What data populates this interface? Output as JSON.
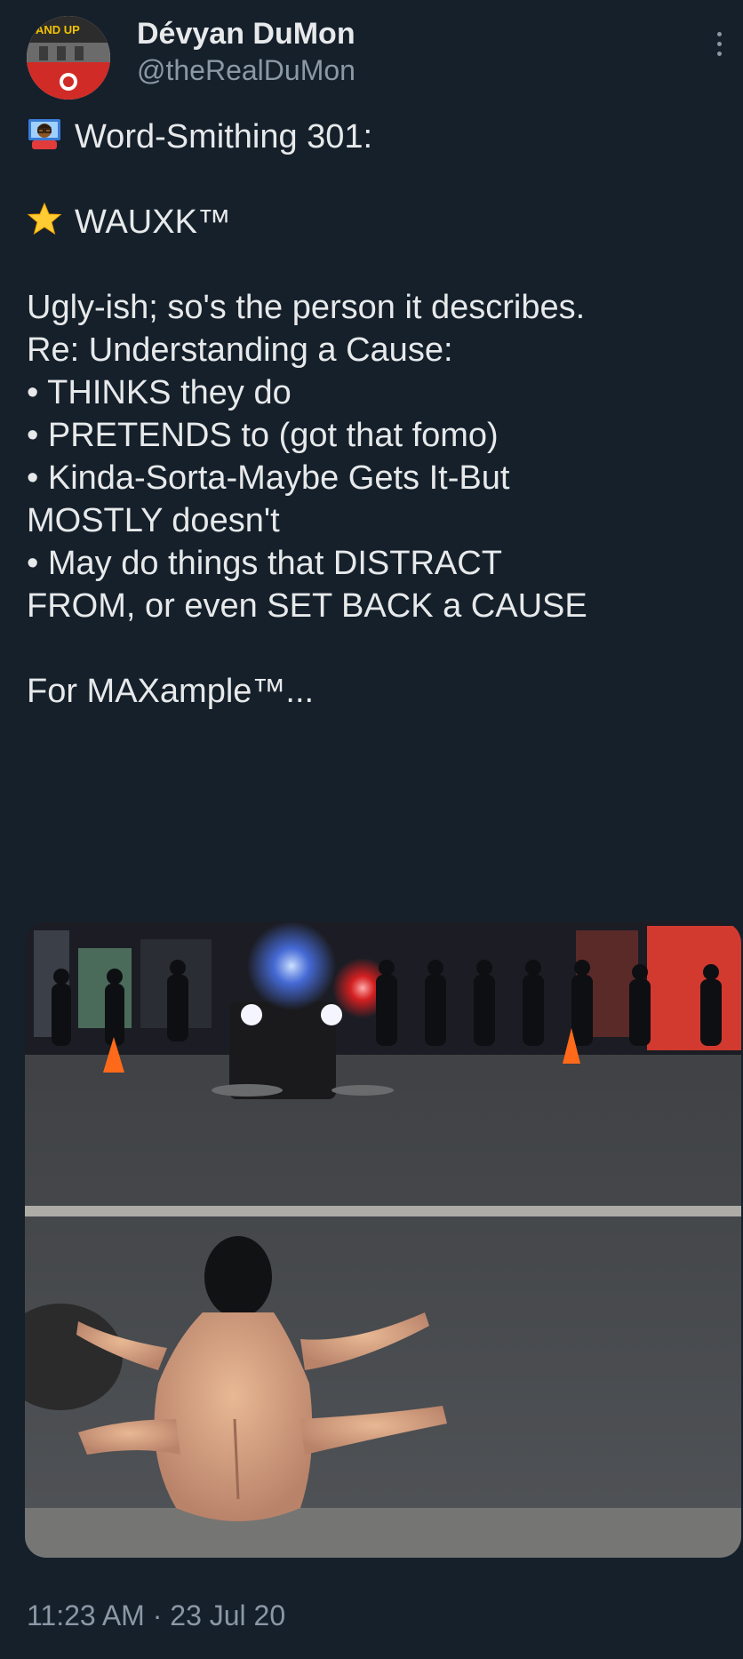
{
  "author": {
    "display_name": "Dévyan DuMon",
    "handle": "@theRealDuMon",
    "avatar_sign": "AND UP"
  },
  "tweet": {
    "heading": "Word-Smithing 301:",
    "term": "WAUXK™",
    "lines": [
      "Ugly-ish; so's the person it describes.",
      "Re: Understanding a Cause:",
      "• THINKS they do",
      "• PRETENDS to (got that fomo)",
      "• Kinda-Sorta-Maybe Gets It-But",
      "MOSTLY doesn't",
      "• May do things that DISTRACT",
      "FROM, or even SET BACK a CAUSE"
    ],
    "closing": "For MAXample™..."
  },
  "timestamp": "11:23 AM · 23 Jul 20",
  "icons": {
    "heading_emoji": "man-technologist-emoji-icon",
    "term_emoji": "star-icon",
    "more": "more-options-icon"
  },
  "colors": {
    "background": "#15202b",
    "text": "#e7e9ea",
    "secondary": "#8b98a5"
  }
}
